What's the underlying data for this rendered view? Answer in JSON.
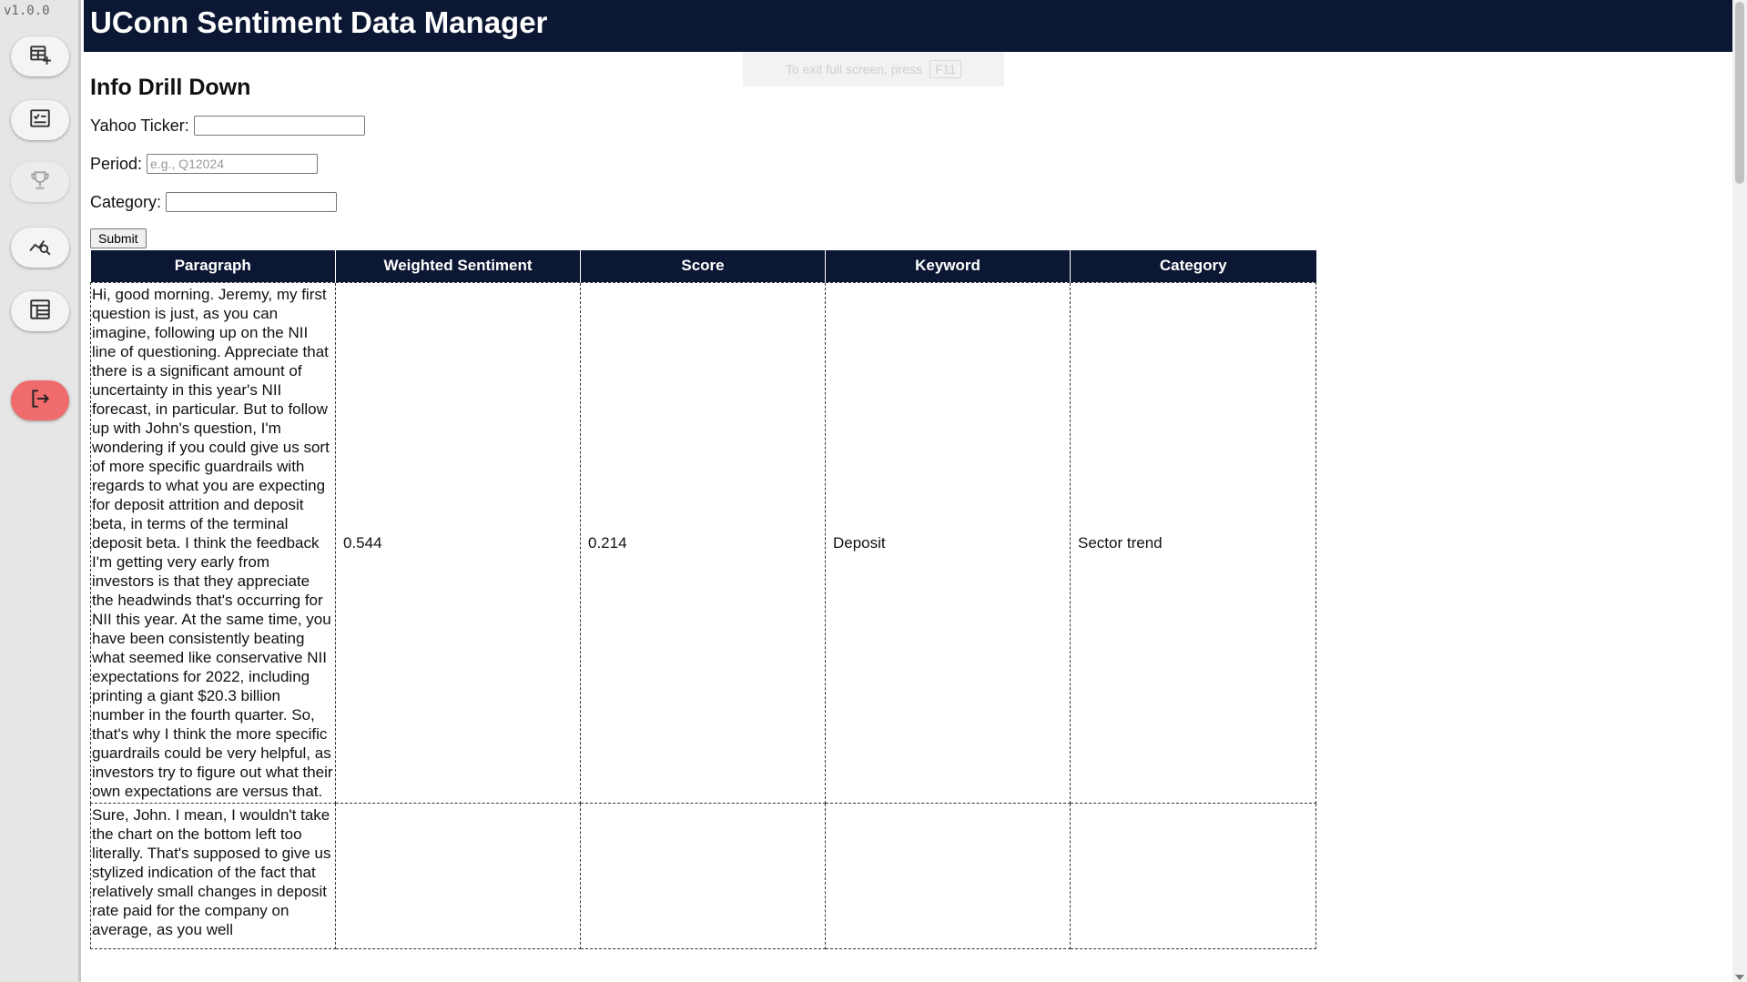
{
  "app": {
    "version": "v1.0.0",
    "title": "UConn Sentiment Data Manager"
  },
  "fullscreen_notice": {
    "text": "To exit full screen, press",
    "key": "F11"
  },
  "sidebar": {
    "buttons": [
      {
        "name": "add-data",
        "icon": "table-add-icon"
      },
      {
        "name": "review",
        "icon": "checklist-icon"
      },
      {
        "name": "awards",
        "icon": "trophy-icon",
        "disabled": true
      },
      {
        "name": "analysis",
        "icon": "chart-search-icon"
      },
      {
        "name": "report",
        "icon": "spreadsheet-icon"
      },
      {
        "name": "logout",
        "icon": "logout-icon",
        "color": "#f06b6b"
      }
    ]
  },
  "page": {
    "heading": "Info Drill Down",
    "form": {
      "ticker_label": "Yahoo Ticker:",
      "ticker_value": "",
      "period_label": "Period:",
      "period_placeholder": "e.g., Q12024",
      "category_label": "Category:",
      "category_value": "",
      "submit_label": "Submit"
    },
    "table": {
      "headers": [
        "Paragraph",
        "Weighted Sentiment",
        "Score",
        "Keyword",
        "Category"
      ],
      "rows": [
        {
          "paragraph": " Hi, good morning. Jeremy, my first question is just, as you can imagine, following up on the NII line of questioning. Appreciate that there is a significant amount of uncertainty in this year's NII forecast, in particular. But to follow up with John's question, I'm wondering if you could give us sort of more specific guardrails with regards to what you are expecting for deposit attrition and deposit beta, in terms of the terminal deposit beta. I think the feedback I'm getting very early from investors is that they appreciate the headwinds that's occurring for NII this year. At the same time, you have been consistently beating what seemed like conservative NII expectations for 2022, including printing a giant $20.3 billion number in the fourth quarter. So, that's why I think the more specific guardrails could be very helpful, as investors try to figure out what their own expectations are versus that.",
          "weighted_sentiment": "0.544",
          "score": "0.214",
          "keyword": "Deposit",
          "category": "Sector trend"
        },
        {
          "paragraph": " Sure, John. I mean, I wouldn't take the chart on the bottom left too literally. That's supposed to give us stylized indication of the fact that relatively small changes in deposit rate paid for the company on average, as you well",
          "weighted_sentiment": "",
          "score": "",
          "keyword": "",
          "category": ""
        }
      ]
    }
  },
  "colors": {
    "header_bg": "#0c1733",
    "sidebar_bg": "#e6e6e6",
    "logout_bg": "#f06b6b"
  }
}
